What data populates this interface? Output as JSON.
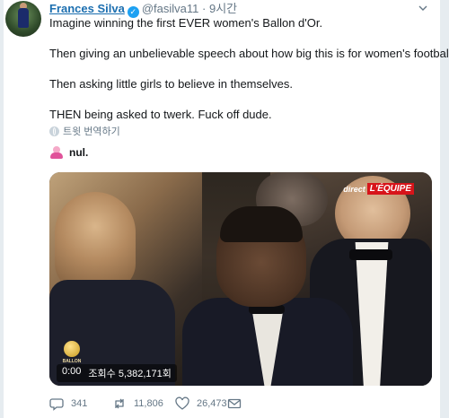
{
  "tweet": {
    "author_name": "Frances Silva",
    "handle": "@fasilva11",
    "separator": "·",
    "time": "9시간",
    "text_lines": [
      "Imagine winning the first EVER women's Ballon d'Or.",
      "Then giving an unbelievable speech about how big this is for women's football.",
      "Then asking little girls to believe in themselves.",
      "THEN being asked to twerk. Fuck off dude."
    ],
    "translate_label": "트윗 번역하기",
    "quoted_text": "nul."
  },
  "video": {
    "brand_prefix": "direct",
    "brand_name": "L'ÉQUIPE",
    "logo_text": "BALLON",
    "time": "0:00",
    "views": "조회수 5,382,171회"
  },
  "actions": {
    "replies": "341",
    "retweets": "11,806",
    "likes": "26,473"
  },
  "colors": {
    "link_blue": "#1c6fb0",
    "verified_blue": "#1da1f2",
    "meta_gray": "#657786",
    "equipe_red": "#d7141a"
  },
  "icons": [
    "verified-badge-icon",
    "chevron-down-icon",
    "globe-icon",
    "reply-icon",
    "retweet-icon",
    "heart-icon",
    "mail-icon"
  ]
}
